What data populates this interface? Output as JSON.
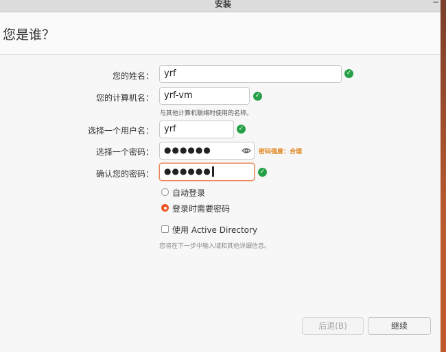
{
  "window": {
    "title": "安装",
    "control": "−"
  },
  "header": {
    "title": "您是谁？"
  },
  "form": {
    "name": {
      "label": "您的姓名：",
      "value": "yrf"
    },
    "computer": {
      "label": "您的计算机名：",
      "value": "yrf-vm",
      "hint": "与其他计算机联络时使用的名称。"
    },
    "username": {
      "label": "选择一个用户名：",
      "value": "yrf"
    },
    "password": {
      "label": "选择一个密码：",
      "masked": "●●●●●●",
      "strength": "密码强度：合理"
    },
    "confirm": {
      "label": "确认您的密码：",
      "masked": "●●●●●●"
    },
    "login_options": [
      {
        "label": "自动登录",
        "selected": false
      },
      {
        "label": "登录时需要密码",
        "selected": true
      }
    ],
    "active_directory": {
      "label": "使用 Active Directory",
      "checked": false
    },
    "note": "您将在下一步中输入域和其他详细信息。"
  },
  "buttons": {
    "back": "后退(B)",
    "continue": "继续"
  },
  "colors": {
    "accent": "#e95420",
    "valid": "#26a148",
    "strength": "#e0861f"
  },
  "icons": {
    "valid": "check-icon",
    "show_password": "eye-icon"
  }
}
